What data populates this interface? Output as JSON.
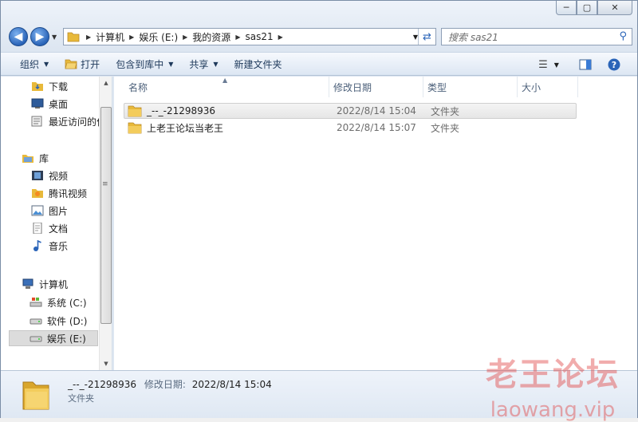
{
  "window": {
    "minimize_glyph": "─",
    "maximize_glyph": "▢",
    "close_glyph": "✕"
  },
  "address": {
    "breadcrumbs": [
      "计算机",
      "娱乐 (E:)",
      "我的资源",
      "sas21"
    ],
    "search_placeholder": "搜索 sas21"
  },
  "toolbar": {
    "organize": "组织",
    "open": "打开",
    "include_in_library": "包含到库中",
    "share": "共享",
    "new_folder": "新建文件夹"
  },
  "navpane": {
    "favorites": [
      {
        "label": "下载",
        "icon": "download-folder-icon"
      },
      {
        "label": "桌面",
        "icon": "desktop-icon"
      },
      {
        "label": "最近访问的位",
        "icon": "recent-places-icon"
      }
    ],
    "libraries_label": "库",
    "libraries": [
      {
        "label": "视频",
        "icon": "video-library-icon"
      },
      {
        "label": "腾讯视频",
        "icon": "tencent-video-icon"
      },
      {
        "label": "图片",
        "icon": "pictures-library-icon"
      },
      {
        "label": "文档",
        "icon": "documents-library-icon"
      },
      {
        "label": "音乐",
        "icon": "music-library-icon"
      }
    ],
    "computer_label": "计算机",
    "drives": [
      {
        "label": "系统 (C:)",
        "icon": "system-drive-icon"
      },
      {
        "label": "软件 (D:)",
        "icon": "drive-icon"
      },
      {
        "label": "娱乐 (E:)",
        "icon": "drive-icon",
        "selected": true
      }
    ]
  },
  "columns": {
    "name": "名称",
    "modified": "修改日期",
    "type": "类型",
    "size": "大小"
  },
  "files": [
    {
      "name": "_--_-21298936",
      "modified": "2022/8/14 15:04",
      "type": "文件夹",
      "selected": true
    },
    {
      "name": "上老王论坛当老王",
      "modified": "2022/8/14 15:07",
      "type": "文件夹",
      "selected": false
    }
  ],
  "details": {
    "name": "_--_-21298936",
    "modified_label": "修改日期:",
    "modified": "2022/8/14 15:04",
    "type": "文件夹"
  },
  "watermark": {
    "line1": "老王论坛",
    "line2": "laowang.vip"
  },
  "colors": {
    "folder": "#e8b93a",
    "accent": "#2a64b8",
    "selection": "#dcdcdc",
    "watermark": "#e14646"
  }
}
